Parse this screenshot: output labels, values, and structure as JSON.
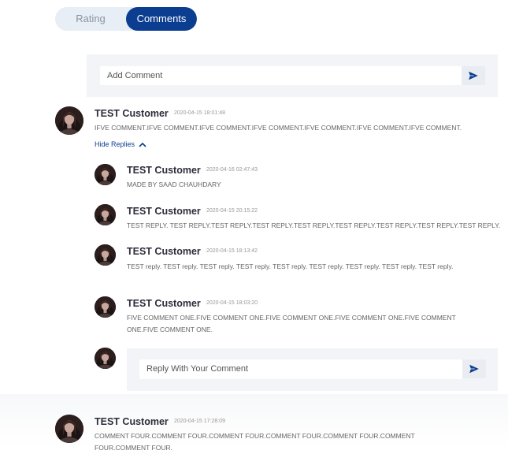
{
  "tabs": {
    "rating": "Rating",
    "comments": "Comments",
    "active": "Comments"
  },
  "add_comment": {
    "placeholder": "Add Comment",
    "send_icon": "send-icon"
  },
  "comments": [
    {
      "name": "TEST Customer",
      "time": "2020-04-15 18:01:48",
      "text": "IFVE COMMENT.IFVE COMMENT.IFVE COMMENT.IFVE COMMENT.IFVE COMMENT.IFVE COMMENT.IFVE COMMENT.",
      "toggle_label": "Hide Replies",
      "replies": [
        {
          "name": "TEST Customer",
          "time": "2020-04-16 02:47:43",
          "text": "MADE BY SAAD CHAUHDARY"
        },
        {
          "name": "TEST Customer",
          "time": "2020-04-15 20:15:22",
          "text": "TEST REPLY. TEST REPLY.TEST REPLY.TEST REPLY.TEST REPLY.TEST REPLY.TEST REPLY.TEST REPLY.TEST REPLY."
        },
        {
          "name": "TEST Customer",
          "time": "2020-04-15 18:13:42",
          "text": "TEST reply. TEST reply. TEST reply. TEST reply. TEST reply. TEST reply. TEST reply. TEST reply. TEST reply."
        },
        {
          "name": "TEST Customer",
          "time": "2020-04-15 18:03:20",
          "text": "FIVE COMMENT ONE.FIVE COMMENT ONE.FIVE COMMENT ONE.FIVE COMMENT ONE.FIVE COMMENT ONE.FIVE COMMENT ONE."
        }
      ],
      "reply_box": {
        "placeholder": "Reply With Your Comment"
      }
    },
    {
      "name": "TEST Customer",
      "time": "2020-04-15 17:28:09",
      "text": "COMMENT FOUR.COMMENT FOUR.COMMENT FOUR.COMMENT FOUR.COMMENT FOUR.COMMENT FOUR.COMMENT FOUR."
    }
  ],
  "colors": {
    "accent": "#0b3d91",
    "panel": "#f2f4f7",
    "tab_bg": "#e8eef5"
  }
}
